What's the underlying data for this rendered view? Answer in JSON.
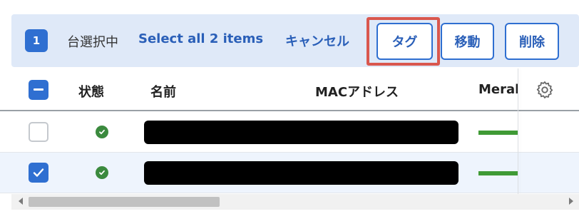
{
  "toolbar": {
    "selected_count": "1",
    "selected_label": "台選択中",
    "select_all_label": "Select all 2 items",
    "cancel_label": "キャンセル",
    "tag_button_label": "タグ",
    "move_button_label": "移動",
    "delete_button_label": "削除",
    "highlight_color": "#d9574e",
    "accent_color": "#2f6fd1"
  },
  "table": {
    "columns": [
      "状態",
      "名前",
      "MACアドレス",
      "Meraki"
    ],
    "header_checkbox_state": "indeterminate",
    "settings_icon": "gear-icon",
    "rows": [
      {
        "selected": false,
        "status": "online",
        "status_icon": "check-circle-icon",
        "name": "[redacted]",
        "status_color": "#3b8a3e"
      },
      {
        "selected": true,
        "status": "online",
        "status_icon": "check-circle-icon",
        "name": "[redacted]",
        "status_color": "#3b8a3e"
      }
    ]
  },
  "scrollbar": {
    "position": 0.0
  }
}
